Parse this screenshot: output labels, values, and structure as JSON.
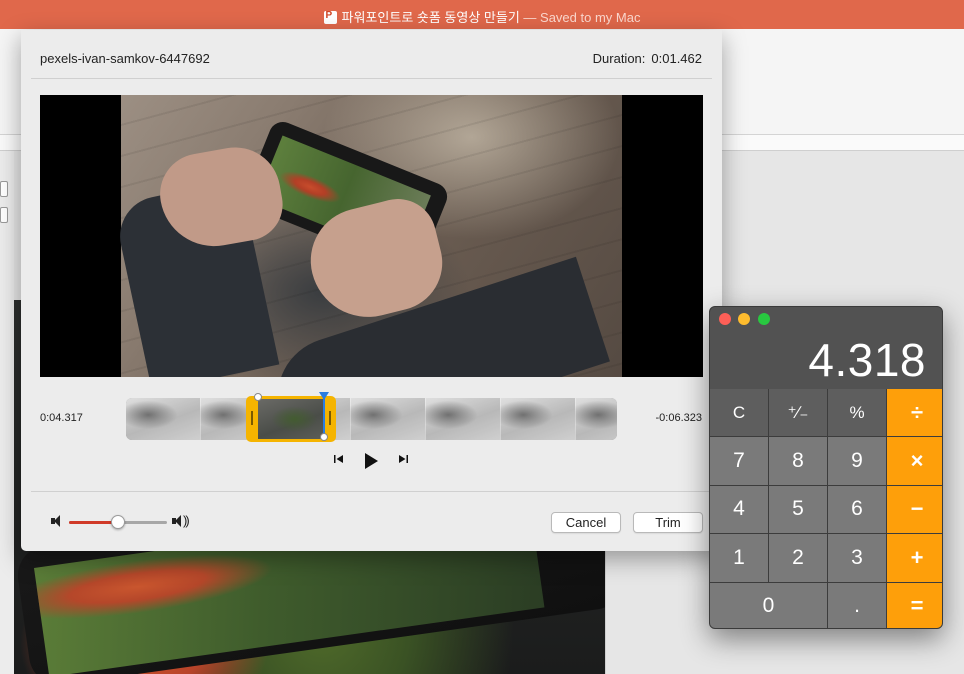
{
  "window": {
    "title": "파워포인트로 숏폼 동영상 만들기",
    "status": "— Saved to my Mac"
  },
  "trim_dialog": {
    "clip_name": "pexels-ivan-samkov-6447692",
    "duration_label": "Duration:",
    "duration_value": "0:01.462",
    "time_elapsed": "0:04.317",
    "time_remaining": "-0:06.323",
    "volume_level": 0.5,
    "buttons": {
      "cancel": "Cancel",
      "trim": "Trim"
    },
    "icons": {
      "prev": "step-back-icon",
      "play": "play-icon",
      "next": "step-forward-icon",
      "vol_low": "speaker-low-icon",
      "vol_high": "speaker-high-icon"
    }
  },
  "calculator": {
    "display": "4.318",
    "keys": [
      {
        "label": "C",
        "type": "fn",
        "name": "clear"
      },
      {
        "label": "⁺∕₋",
        "type": "fn",
        "name": "plus-minus"
      },
      {
        "label": "%",
        "type": "fn",
        "name": "percent"
      },
      {
        "label": "÷",
        "type": "op",
        "name": "divide"
      },
      {
        "label": "7",
        "type": "num",
        "name": "7"
      },
      {
        "label": "8",
        "type": "num",
        "name": "8"
      },
      {
        "label": "9",
        "type": "num",
        "name": "9"
      },
      {
        "label": "×",
        "type": "op",
        "name": "multiply"
      },
      {
        "label": "4",
        "type": "num",
        "name": "4"
      },
      {
        "label": "5",
        "type": "num",
        "name": "5"
      },
      {
        "label": "6",
        "type": "num",
        "name": "6"
      },
      {
        "label": "−",
        "type": "op",
        "name": "subtract"
      },
      {
        "label": "1",
        "type": "num",
        "name": "1"
      },
      {
        "label": "2",
        "type": "num",
        "name": "2"
      },
      {
        "label": "3",
        "type": "num",
        "name": "3"
      },
      {
        "label": "+",
        "type": "op",
        "name": "add"
      },
      {
        "label": "0",
        "type": "num",
        "name": "0"
      },
      {
        "label": ".",
        "type": "num",
        "name": "decimal"
      },
      {
        "label": "=",
        "type": "op",
        "name": "equals"
      }
    ],
    "colors": {
      "operator": "#fe9f0a",
      "close": "#fd5f57",
      "minimize": "#febc2e",
      "zoom": "#28c840"
    }
  },
  "colors": {
    "titlebar": "#e0684b",
    "selection": "#f5b400",
    "playhead": "#2a7de1",
    "volume_fill": "#d03a28"
  }
}
